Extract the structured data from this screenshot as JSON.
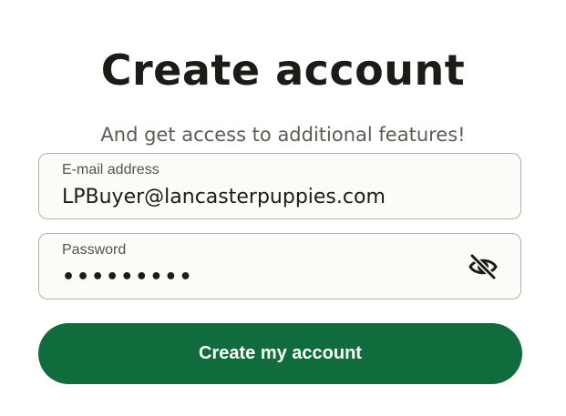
{
  "heading": {
    "title": "Create account",
    "subtitle": "And get access to additional features!"
  },
  "form": {
    "email": {
      "label": "E-mail address",
      "value": "LPBuyer@lancasterpuppies.com"
    },
    "password": {
      "label": "Password",
      "value": "•••••••••",
      "toggle_icon": "eye-slash-icon"
    },
    "submit_label": "Create my account"
  },
  "colors": {
    "primary_button": "#106b3d",
    "title_text": "#1c1b17",
    "subtitle_text": "#5d5b53",
    "field_border": "#b9b3a5",
    "field_background": "#fcfbf7"
  }
}
